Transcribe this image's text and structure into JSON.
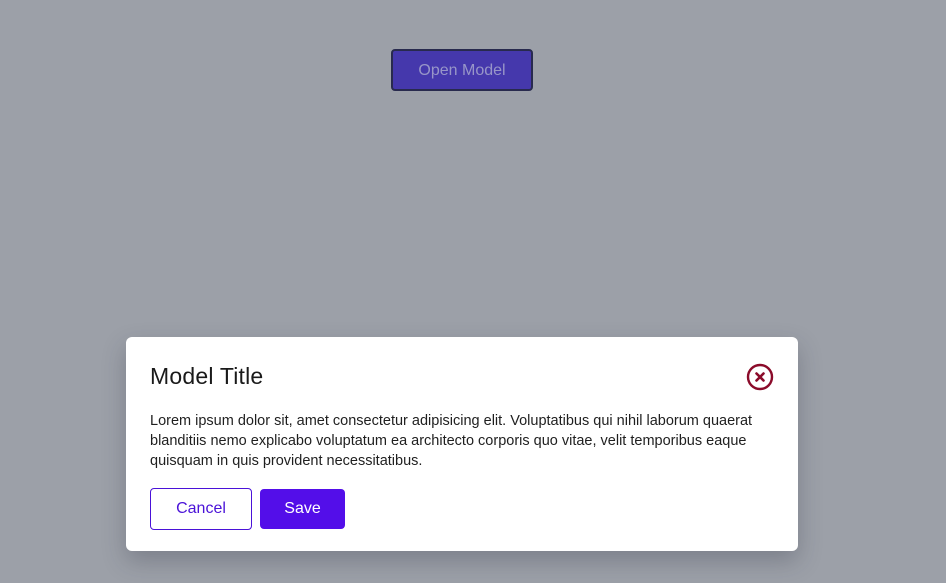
{
  "page": {
    "open_button_label": "Open Model"
  },
  "modal": {
    "title": "Model Title",
    "close_icon": "close-circle-icon",
    "body": "Lorem ipsum dolor sit, amet consectetur adipisicing elit. Voluptatibus qui nihil laborum quaerat blanditiis nemo explicabo voluptatum ea architecto corporis quo vitae, velit temporibus eaque quisquam in quis provident necessitatibus.",
    "cancel_label": "Cancel",
    "save_label": "Save"
  },
  "colors": {
    "overlay": "#9ca0a8",
    "accent": "#530ee9",
    "close_icon": "#8b0b2a",
    "open_button": "#4538ac"
  }
}
